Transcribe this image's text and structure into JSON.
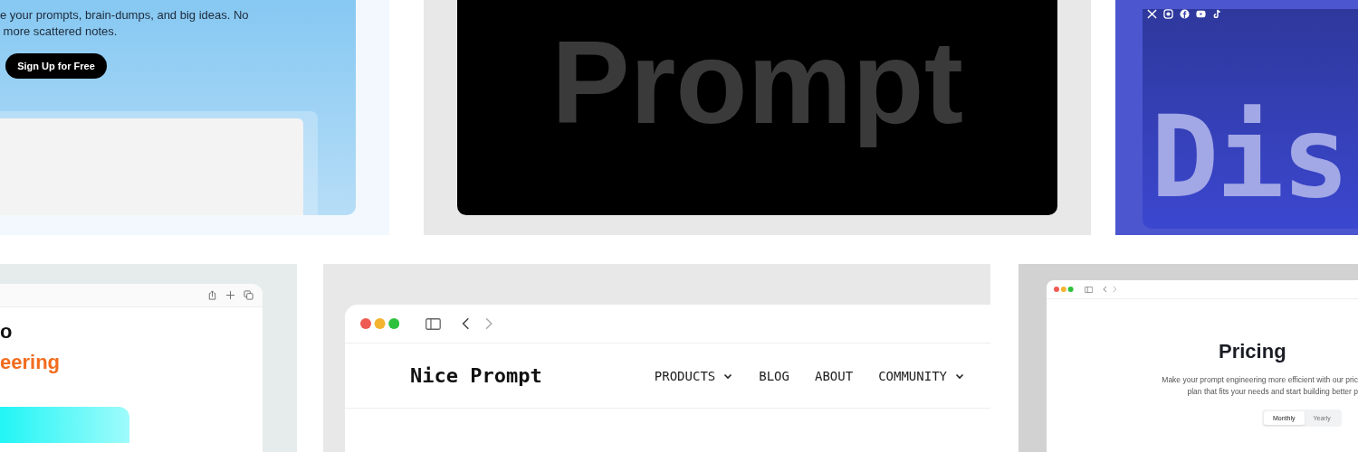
{
  "tiles": [
    {
      "kind": "hero",
      "text": "e your prompts, brain-dumps, and big ideas. No\n more scattered notes.",
      "button": "Sign Up for Free"
    },
    {
      "kind": "wordmark",
      "word": "Prompt"
    },
    {
      "kind": "footer",
      "word": "Dis"
    },
    {
      "kind": "engineering",
      "line_1": "o",
      "line_2": "eering"
    },
    {
      "kind": "navbar",
      "logo": "Nice Prompt",
      "nav": [
        {
          "label": "PRODUCTS",
          "dropdown": true
        },
        {
          "label": "BLOG",
          "dropdown": false
        },
        {
          "label": "ABOUT",
          "dropdown": false
        },
        {
          "label": "COMMUNITY",
          "dropdown": true
        }
      ]
    },
    {
      "kind": "pricing",
      "title": "Pricing",
      "text": "Make your prompt engineering more efficient with our pric\nplan that fits your needs and start building better p",
      "toggle": [
        {
          "label": "Monthly",
          "selected": true
        },
        {
          "label": "Yearly",
          "selected": false
        }
      ]
    }
  ]
}
